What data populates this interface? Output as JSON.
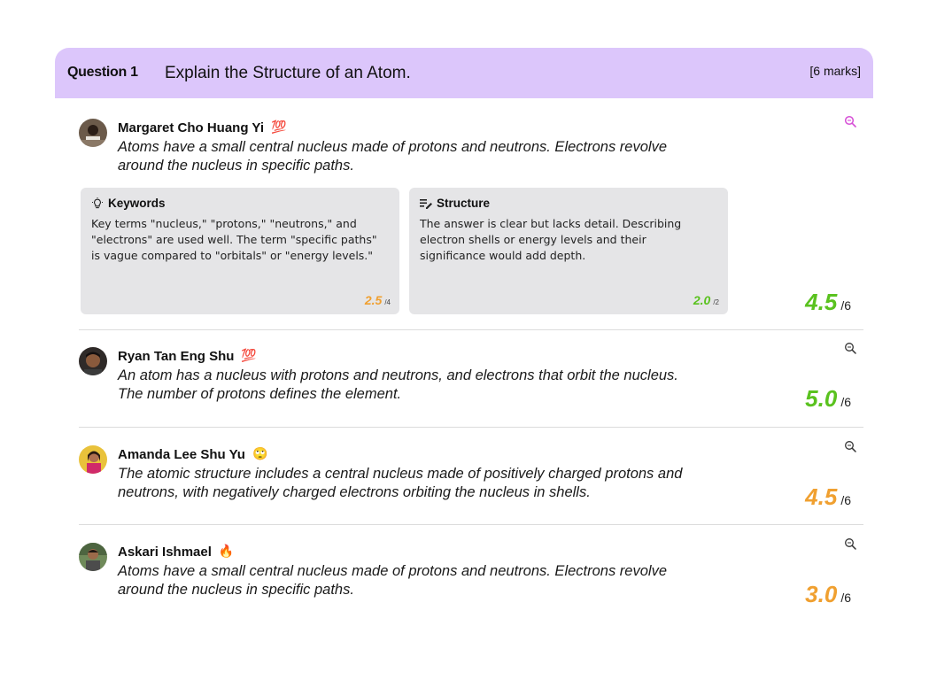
{
  "question": {
    "label": "Question 1",
    "text": "Explain the Structure of an Atom.",
    "marks": "[6 marks]"
  },
  "colors": {
    "header_bg": "#dcc6fb",
    "score_green": "#5ac21f",
    "score_orange": "#f0a030",
    "zoom_active": "#d64fd6"
  },
  "responses": [
    {
      "name": "Margaret Cho Huang Yi",
      "emoji": "💯",
      "answer": "Atoms have a small central nucleus made of protons and neutrons. Electrons revolve around the nucleus in specific paths.",
      "score": "4.5",
      "score_denom": "/6",
      "feedback": [
        {
          "icon": "lightbulb-icon",
          "title": "Keywords",
          "text": "Key terms \"nucleus,\" \"protons,\" \"neutrons,\" and \"electrons\" are used well. The term \"specific paths\" is vague compared to \"orbitals\" or \"energy levels.\"",
          "score": "2.5",
          "score_denom": "/4"
        },
        {
          "icon": "notes-icon",
          "title": "Structure",
          "text": "The answer is clear but lacks detail. Describing electron shells or energy levels and their significance would add depth.",
          "score": "2.0",
          "score_denom": "/2"
        }
      ]
    },
    {
      "name": "Ryan Tan Eng Shu",
      "emoji": "💯",
      "answer": "An atom has a nucleus with protons and neutrons, and electrons that orbit the nucleus. The number of protons defines the element.",
      "score": "5.0",
      "score_denom": "/6"
    },
    {
      "name": "Amanda Lee Shu Yu",
      "emoji": "🙄",
      "answer": "The atomic structure includes a central nucleus made of positively charged protons and neutrons, with negatively charged electrons orbiting the nucleus in shells.",
      "score": "4.5",
      "score_denom": "/6"
    },
    {
      "name": "Askari Ishmael",
      "emoji": "🔥",
      "answer": "Atoms have a small central nucleus made of protons and neutrons. Electrons revolve around the nucleus in specific paths.",
      "score": "3.0",
      "score_denom": "/6"
    }
  ]
}
